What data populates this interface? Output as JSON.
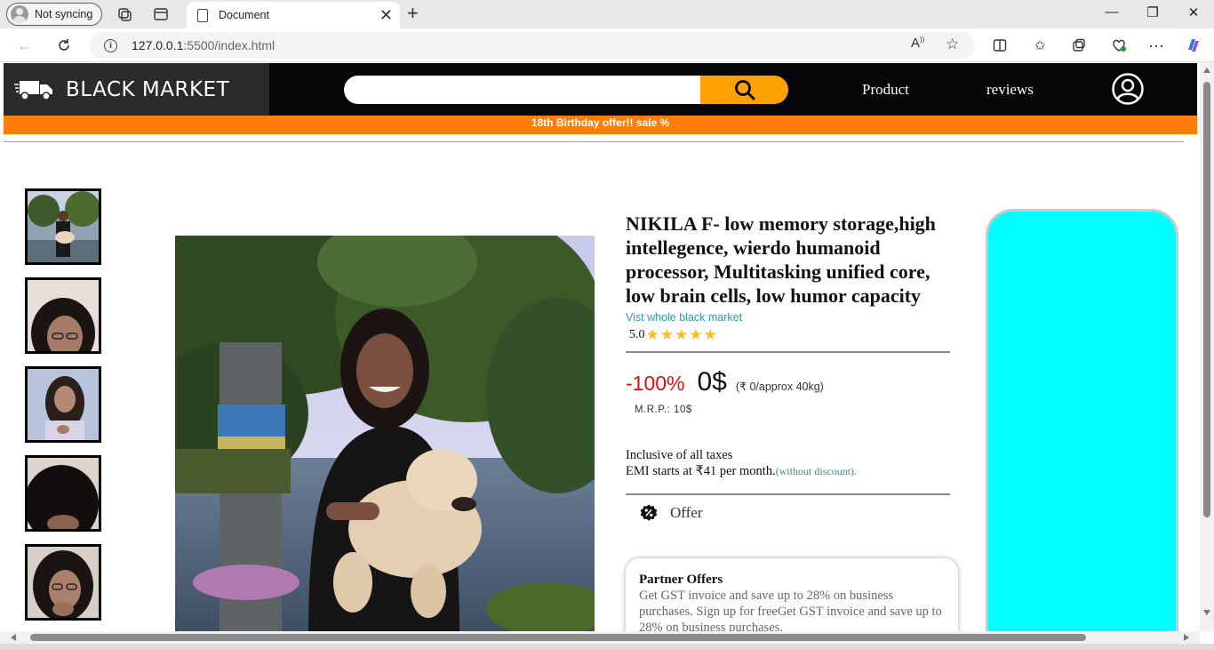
{
  "browser": {
    "profile_label": "Not syncing",
    "tab_title": "Document",
    "url_host": "127.0.0.1",
    "url_path": ":5500/index.html"
  },
  "site": {
    "brand": "BLACK MARKET",
    "search_placeholder": "",
    "nav": [
      {
        "label": "Product"
      },
      {
        "label": "reviews"
      }
    ],
    "promo": "18th Birthday offer!! sale %"
  },
  "product": {
    "title": "NIKILA F- low memory storage,high intellegence, wierdo humanoid processor, Multitasking unified core, low brain cells, low humor capacity",
    "visit_link": "Vist whole black market",
    "rating_value": "5.0",
    "stars": 5,
    "discount": "-100%",
    "price": "0$",
    "approx": "(₹ 0/approx 40kg)",
    "mrp": "M.R.P.: 10$",
    "tax_line": "Inclusive of all taxes",
    "emi_line": "EMI starts at ₹41 per month.",
    "emi_note": "(without discount).",
    "offer_label": "Offer",
    "partner_title": "Partner Offers",
    "partner_text": "Get GST invoice and save up to 28% on business purchases. Sign up for freeGet GST invoice and save up to 28% on business purchases."
  },
  "colors": {
    "header_bg": "#060508",
    "promo_bg": "#fe7d0b",
    "search_button": "#fea201",
    "buy_box": "#00ffff",
    "discount": "#e40c0c",
    "link": "#2f9aa1",
    "stars": "#fbbd23"
  },
  "icons": {
    "logo": "delivery-truck-icon",
    "search": "search-icon",
    "account": "user-circle-icon",
    "offer": "percent-badge-icon"
  }
}
